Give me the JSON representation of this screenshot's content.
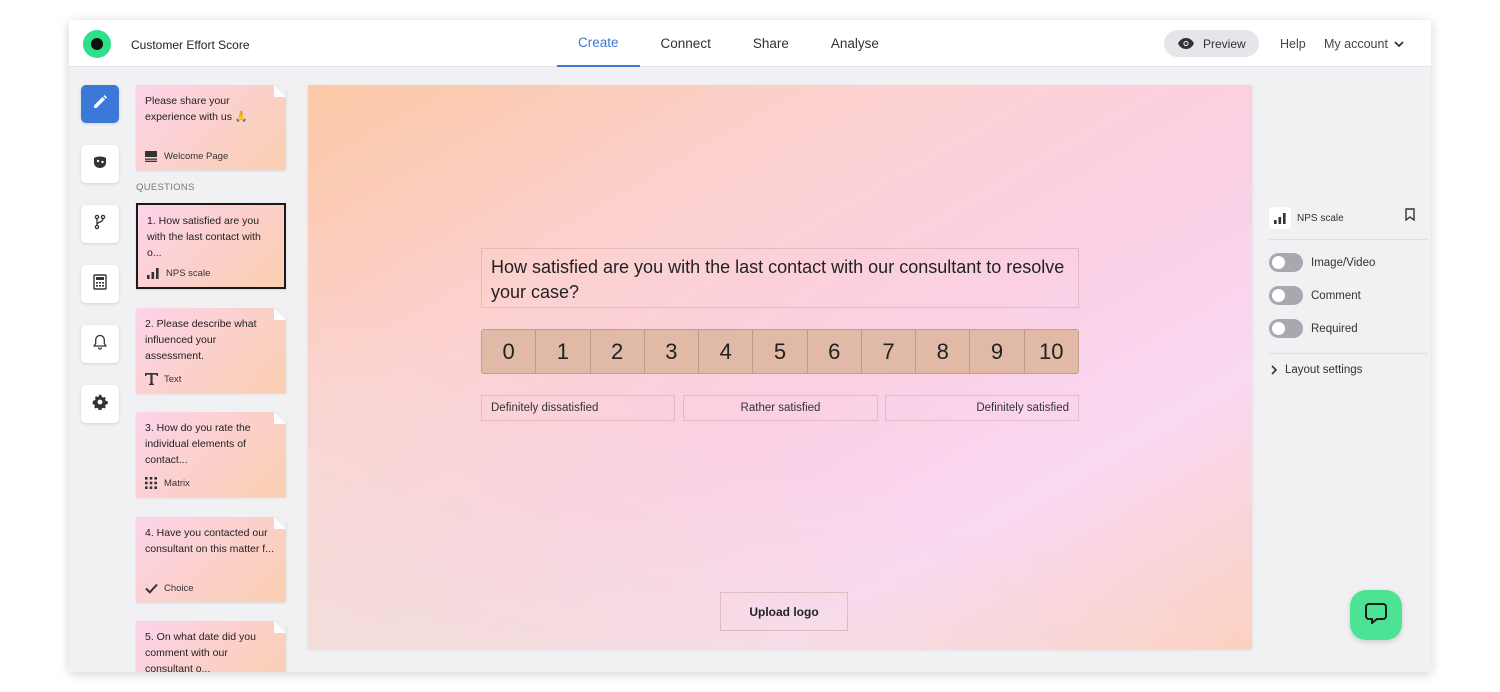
{
  "app": {
    "title": "Customer Effort Score",
    "logo_icon": "logo-icon",
    "accent_color": "#3a78d6"
  },
  "nav": {
    "tabs": [
      {
        "label": "Create",
        "active": true
      },
      {
        "label": "Connect",
        "active": false
      },
      {
        "label": "Share",
        "active": false
      },
      {
        "label": "Analyse",
        "active": false
      }
    ],
    "preview_label": "Preview",
    "help_label": "Help",
    "account_label": "My account"
  },
  "rail": {
    "items": [
      {
        "icon": "pencil-icon",
        "active": true
      },
      {
        "icon": "theme-icon",
        "active": false
      },
      {
        "icon": "branch-icon",
        "active": false
      },
      {
        "icon": "calculator-icon",
        "active": false
      },
      {
        "icon": "bell-icon",
        "active": false
      },
      {
        "icon": "gear-icon",
        "active": false
      }
    ]
  },
  "sidebar": {
    "welcome": {
      "text": "Please share your experience with us 🙏",
      "type_label": "Welcome Page",
      "type_icon": "welcome-page-icon"
    },
    "questions_heading": "QUESTIONS",
    "questions": [
      {
        "text": "1. How satisfied are you with the last contact with o...",
        "type_label": "NPS scale",
        "type_icon": "nps-scale-icon",
        "selected": true
      },
      {
        "text": "2. Please describe what influenced your assessment.",
        "type_label": "Text",
        "type_icon": "text-type-icon",
        "selected": false
      },
      {
        "text": "3. How do you rate the individual elements of contact...",
        "type_label": "Matrix",
        "type_icon": "matrix-icon",
        "selected": false
      },
      {
        "text": "4. Have you contacted our consultant on this matter f...",
        "type_label": "Choice",
        "type_icon": "check-icon",
        "selected": false
      },
      {
        "text": "5. On what date did you comment with our consultant o...",
        "type_label": "",
        "type_icon": "",
        "selected": false
      }
    ]
  },
  "canvas": {
    "question": "How satisfied are you with the last contact with our consultant to resolve your case?",
    "scale": [
      "0",
      "1",
      "2",
      "3",
      "4",
      "5",
      "6",
      "7",
      "8",
      "9",
      "10"
    ],
    "labels": {
      "left": "Definitely dissatisfied",
      "middle": "Rather satisfied",
      "right": "Definitely satisfied"
    },
    "upload_logo": "Upload logo"
  },
  "right_panel": {
    "type_label": "NPS scale",
    "toggles": [
      {
        "label": "Image/Video",
        "on": false
      },
      {
        "label": "Comment",
        "on": false
      },
      {
        "label": "Required",
        "on": false
      }
    ],
    "layout_settings": "Layout settings"
  },
  "chat": {
    "icon": "chat-bubble-icon",
    "color": "#4de394"
  }
}
